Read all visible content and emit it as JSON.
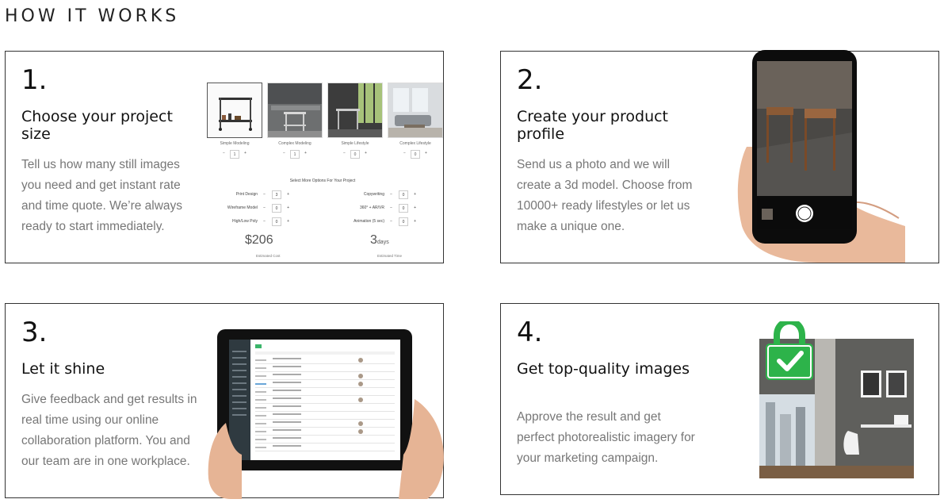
{
  "section_title": "HOW IT WORKS",
  "cards": [
    {
      "number": "1.",
      "heading": "Choose your project size",
      "description": "Tell us how many still images you need and get instant rate and time quote. We’re always ready to start immediately."
    },
    {
      "number": "2.",
      "heading": "Create your product profile",
      "description": "Send us a photo and we will create a 3d model. Choose from 10000+ ready lifestyles or let us make a unique one."
    },
    {
      "number": "3.",
      "heading": "Let it shine",
      "description": "Give feedback and get results in real time using our online collaboration platform. You and our team are in one workplace."
    },
    {
      "number": "4.",
      "heading": "Get top-quality images",
      "description": "Approve the result and get perfect photorealistic imagery for your marketing campaign."
    }
  ],
  "calculator": {
    "types": [
      {
        "label": "Simple Modeling",
        "qty": "1"
      },
      {
        "label": "Complex Modeling",
        "qty": "1"
      },
      {
        "label": "Simple Lifestyle",
        "qty": "0"
      },
      {
        "label": "Complex Lifestyle",
        "qty": "0"
      }
    ],
    "options_title": "Select More Options For Your Project",
    "options": [
      {
        "label": "Print Design",
        "qty": "3"
      },
      {
        "label": "Copywriting",
        "qty": "0"
      },
      {
        "label": "Wireframe Model",
        "qty": "0"
      },
      {
        "label": "360° + AR/VR",
        "qty": "0"
      },
      {
        "label": "High/Low Poly",
        "qty": "0"
      },
      {
        "label": "Animation (5 sec)",
        "qty": "0"
      }
    ],
    "price": "$206",
    "days_value": "3",
    "days_unit": "days",
    "price_caption": "Estimated Cost",
    "time_caption": "Estimated Time"
  },
  "colors": {
    "card_border": "#333333",
    "heading": "#111111",
    "body_text": "#777777",
    "lock_green": "#2db34a"
  },
  "icons": {
    "lock": "padlock-check-icon"
  }
}
